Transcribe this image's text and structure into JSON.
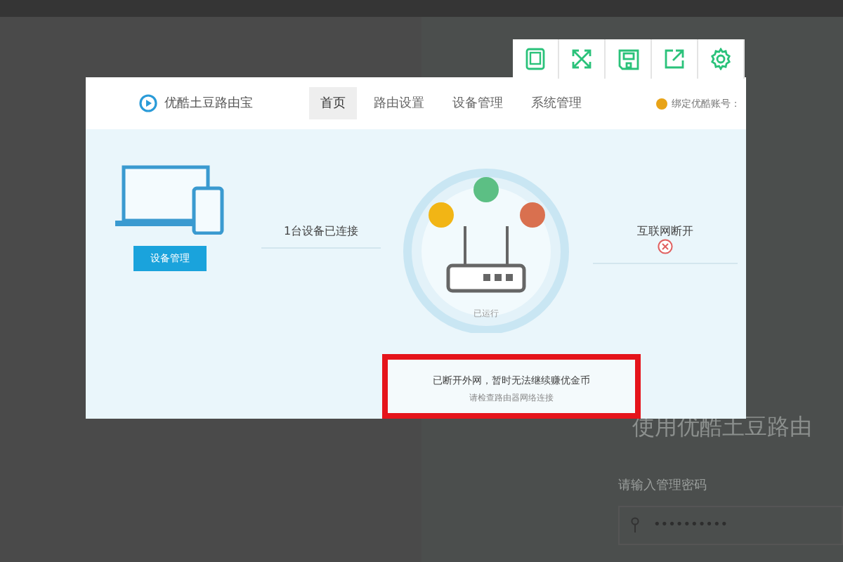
{
  "viewer_toolbar": {
    "buttons": [
      {
        "kind": "tablet"
      },
      {
        "kind": "expand"
      },
      {
        "kind": "save"
      },
      {
        "kind": "share"
      },
      {
        "kind": "settings"
      }
    ]
  },
  "background_page": {
    "heading": "使用优酷土豆路由",
    "password_label": "请输入管理密码",
    "password_value": "••••••••••"
  },
  "screenshot": {
    "brand": "优酷土豆路由宝",
    "tabs": [
      {
        "label": "首页",
        "selected": true
      },
      {
        "label": "路由设置",
        "selected": false
      },
      {
        "label": "设备管理",
        "selected": false
      },
      {
        "label": "系统管理",
        "selected": false
      }
    ],
    "account": "绑定优酷账号：",
    "devices_text": "1台设备已连接",
    "devices_button": "设备管理",
    "router_status": "已运行",
    "internet_status": "互联网断开",
    "internet_connected": false,
    "alert": {
      "message": "已断开外网，暂时无法继续赚优金币",
      "hint": "请检查路由器网络连接",
      "highlighted": true
    }
  }
}
